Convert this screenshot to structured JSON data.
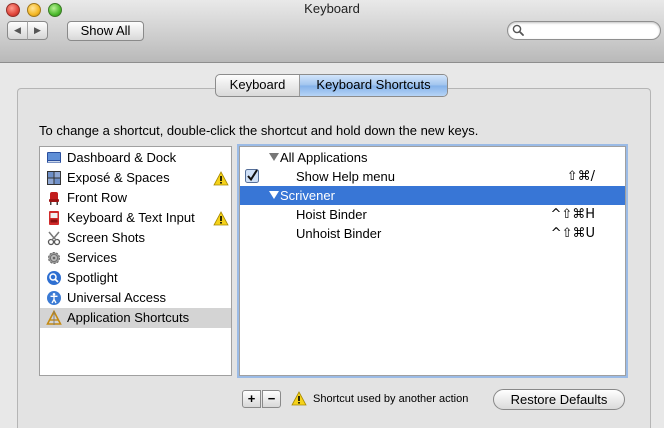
{
  "window": {
    "title": "Keyboard"
  },
  "toolbar": {
    "back_label": "◀",
    "forward_label": "▶",
    "show_all_label": "Show All",
    "search_value": ""
  },
  "tabs": [
    {
      "label": "Keyboard",
      "selected": false
    },
    {
      "label": "Keyboard Shortcuts",
      "selected": true
    }
  ],
  "instructions": "To change a shortcut, double-click the shortcut and hold down the new keys.",
  "categories": [
    {
      "label": "Dashboard & Dock",
      "icon": "dashboard-dock-icon",
      "warning": false
    },
    {
      "label": "Exposé & Spaces",
      "icon": "expose-spaces-icon",
      "warning": true
    },
    {
      "label": "Front Row",
      "icon": "front-row-icon",
      "warning": false
    },
    {
      "label": "Keyboard & Text Input",
      "icon": "keyboard-text-input-icon",
      "warning": true
    },
    {
      "label": "Screen Shots",
      "icon": "screen-shots-icon",
      "warning": false
    },
    {
      "label": "Services",
      "icon": "services-gear-icon",
      "warning": false
    },
    {
      "label": "Spotlight",
      "icon": "spotlight-icon",
      "warning": false
    },
    {
      "label": "Universal Access",
      "icon": "universal-access-icon",
      "warning": false
    },
    {
      "label": "Application Shortcuts",
      "icon": "application-shortcuts-icon",
      "warning": false,
      "selected": true
    }
  ],
  "shortcuts": [
    {
      "label": "All Applications",
      "type": "group",
      "expanded": true,
      "selected": false
    },
    {
      "label": "Show Help menu",
      "type": "item",
      "checked": true,
      "key": "⇧⌘/"
    },
    {
      "label": "Scrivener",
      "type": "group",
      "expanded": true,
      "selected": true
    },
    {
      "label": "Hoist Binder",
      "type": "item",
      "key": "^⇧⌘H"
    },
    {
      "label": "Unhoist Binder",
      "type": "item",
      "key": "^⇧⌘U"
    }
  ],
  "bottom": {
    "add_label": "+",
    "remove_label": "−",
    "legend_text": "Shortcut used by another action",
    "restore_label": "Restore Defaults"
  },
  "colors": {
    "selection": "#3876d6",
    "warning": "#f5d21a"
  }
}
